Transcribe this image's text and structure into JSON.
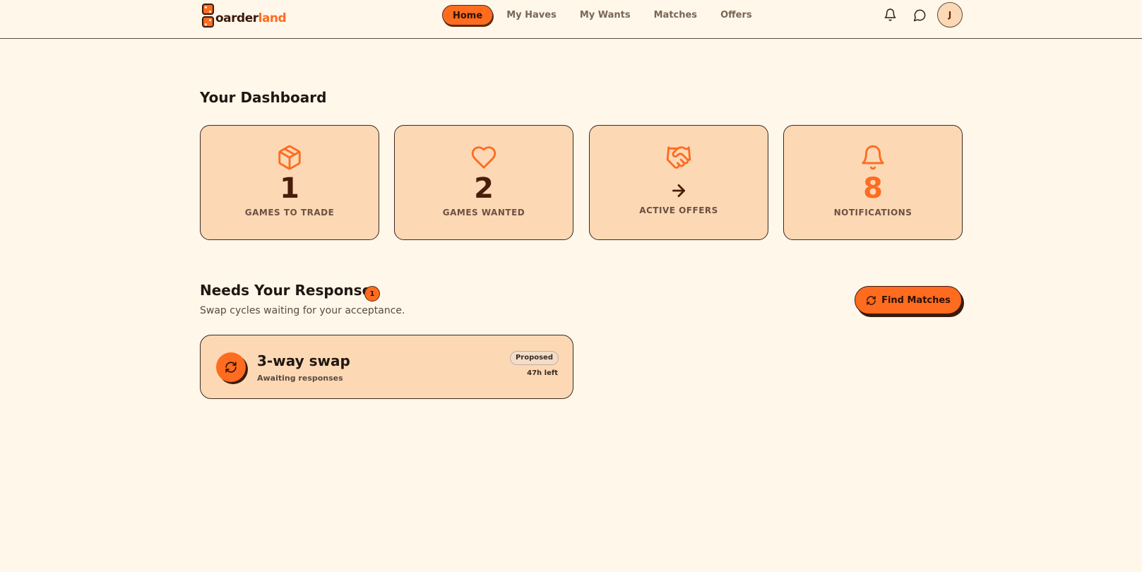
{
  "app": {
    "logo_text_main": "oarder",
    "logo_text_accent": "land"
  },
  "nav": {
    "items": [
      {
        "label": "Home",
        "active": true
      },
      {
        "label": "My Haves",
        "active": false
      },
      {
        "label": "My Wants",
        "active": false
      },
      {
        "label": "Matches",
        "active": false
      },
      {
        "label": "Offers",
        "active": false
      }
    ]
  },
  "header": {
    "notifications_icon": "bell-icon",
    "messages_icon": "chat-icon",
    "avatar_initial": "J"
  },
  "dashboard": {
    "title": "Your Dashboard",
    "stats": [
      {
        "icon": "box-icon",
        "value": "1",
        "label": "GAMES TO TRADE"
      },
      {
        "icon": "heart-icon",
        "value": "2",
        "label": "GAMES WANTED"
      },
      {
        "icon": "handshake-icon",
        "value": "",
        "label": "ACTIVE OFFERS"
      },
      {
        "icon": "bell-icon",
        "value": "8",
        "label": "NOTIFICATIONS"
      }
    ]
  },
  "needs_response": {
    "title": "Needs Your Response",
    "count": "1",
    "subtitle": "Swap cycles waiting for your acceptance.",
    "find_button": "Find Matches",
    "cards": [
      {
        "title": "3-way swap",
        "subtitle": "Awaiting responses",
        "status": "Proposed",
        "time_left": "47h left"
      }
    ]
  },
  "colors": {
    "accent": "#ff6b1f",
    "background": "#fff7ea",
    "card": "#fdd8b5",
    "dark_brown": "#4a1d0a"
  }
}
